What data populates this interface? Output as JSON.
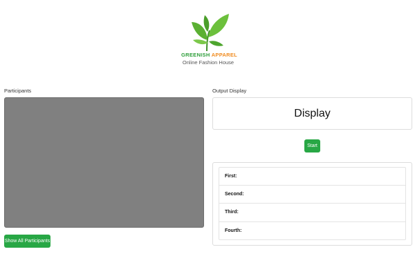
{
  "logo": {
    "brand_green": "GREENISH",
    "brand_orange": "APPAREL",
    "tagline": "Online Fashion House"
  },
  "participants": {
    "label": "Participants",
    "show_all_button": "Show All Participants"
  },
  "output": {
    "label": "Output Display",
    "display_text": "Display",
    "start_button": "Start",
    "results": [
      {
        "label": "First:"
      },
      {
        "label": "Second:"
      },
      {
        "label": "Third:"
      },
      {
        "label": "Fourth:"
      }
    ]
  },
  "colors": {
    "accent_green": "#28a745",
    "panel_gray": "#808080",
    "brand_orange": "#f08a1c"
  }
}
